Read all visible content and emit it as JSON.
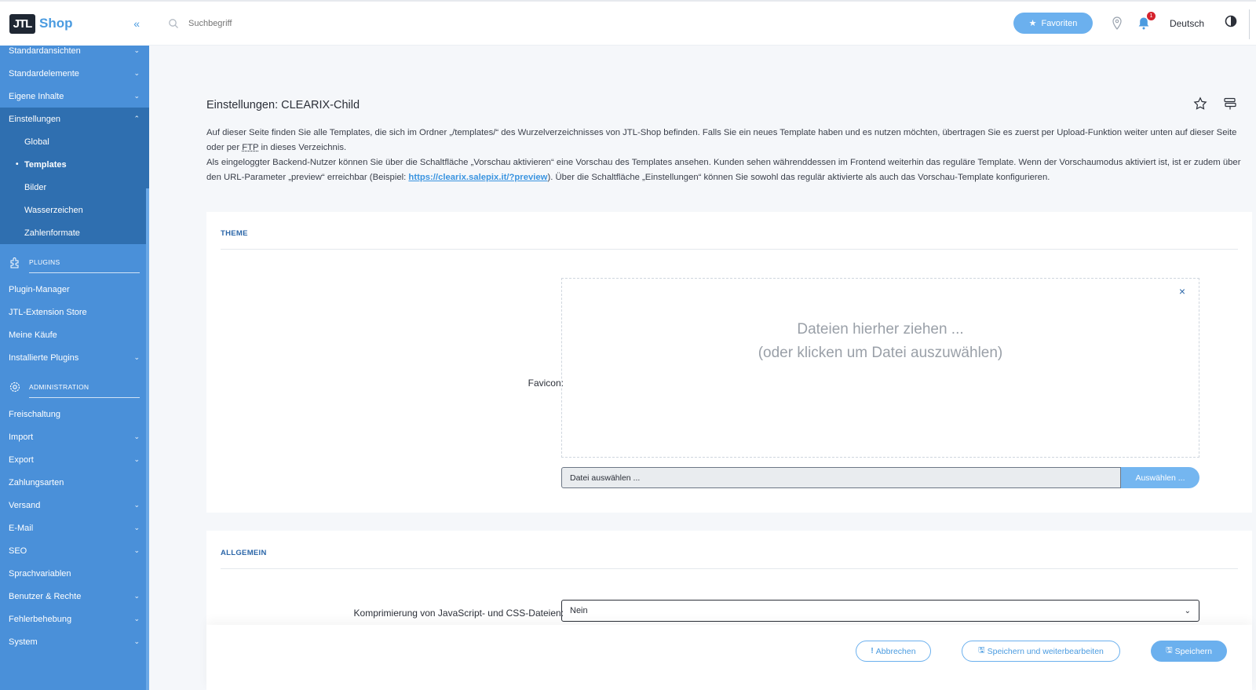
{
  "brand": {
    "logo": "JTL",
    "name": "Shop"
  },
  "sidebar": {
    "items_top": [
      {
        "label": "Standardansichten",
        "chevron": "v"
      },
      {
        "label": "Standardelemente",
        "chevron": "v"
      },
      {
        "label": "Eigene Inhalte",
        "chevron": "v"
      },
      {
        "label": "Einstellungen",
        "chevron": "^"
      }
    ],
    "sub_items": [
      {
        "label": "Global"
      },
      {
        "label": "Templates",
        "bullet": "•"
      },
      {
        "label": "Bilder"
      },
      {
        "label": "Wasserzeichen"
      },
      {
        "label": "Zahlenformate"
      }
    ],
    "plugins_section": "PLUGINS",
    "plugins_items": [
      {
        "label": "Plugin-Manager",
        "chevron": ""
      },
      {
        "label": "JTL-Extension Store",
        "chevron": ""
      },
      {
        "label": "Meine Käufe",
        "chevron": ""
      },
      {
        "label": "Installierte Plugins",
        "chevron": "v"
      }
    ],
    "admin_section": "ADMINISTRATION",
    "admin_items": [
      {
        "label": "Freischaltung",
        "chevron": ""
      },
      {
        "label": "Import",
        "chevron": "v"
      },
      {
        "label": "Export",
        "chevron": "v"
      },
      {
        "label": "Zahlungsarten",
        "chevron": ""
      },
      {
        "label": "Versand",
        "chevron": "v"
      },
      {
        "label": "E-Mail",
        "chevron": "v"
      },
      {
        "label": "SEO",
        "chevron": "v"
      },
      {
        "label": "Sprachvariablen",
        "chevron": ""
      },
      {
        "label": "Benutzer & Rechte",
        "chevron": "v"
      },
      {
        "label": "Fehlerbehebung",
        "chevron": "v"
      },
      {
        "label": "System",
        "chevron": "v"
      }
    ]
  },
  "topbar": {
    "search_placeholder": "Suchbegriff",
    "favorites_label": "Favoriten",
    "notification_count": "1",
    "language": "Deutsch"
  },
  "page": {
    "title": "Einstellungen: CLEARIX-Child",
    "desc_1a": "Auf dieser Seite finden Sie alle Templates, die sich im Ordner „/templates/“ des Wurzelverzeichnisses von JTL-Shop befinden. Falls Sie ein neues Template haben und es nutzen möchten, übertragen Sie es zuerst per Upload-Funktion weiter unten auf dieser Seite oder per ",
    "desc_1_abbr": "FTP",
    "desc_1b": " in dieses Verzeichnis.",
    "desc_2a": "Als eingeloggter Backend-Nutzer können Sie über die Schaltfläche „Vorschau aktivieren“ eine Vorschau des Templates ansehen. Kunden sehen währenddessen im Frontend weiterhin das reguläre Template. Wenn der Vorschaumodus aktiviert ist, ist er zudem über den URL-Parameter „preview“ erreichbar (Beispiel: ",
    "desc_2_link": "https://clearix.salepix.it/?preview",
    "desc_2b": "). Über die Schaltfläche „Einstellungen“ können Sie sowohl das regulär aktivierte als auch das Vorschau-Template konfigurieren."
  },
  "theme_card": {
    "title": "THEME",
    "favicon_label": "Favicon:",
    "dropzone_line1": "Dateien hierher ziehen ...",
    "dropzone_line2": "(oder klicken um Datei auszuwählen)",
    "close_symbol": "×",
    "file_placeholder": "Datei auswählen ...",
    "file_button": "Auswählen ..."
  },
  "general_card": {
    "title": "ALLGEMEIN",
    "compress_label": "Komprimierung von JavaScript- und CSS-Dateien:",
    "compress_value": "Nein"
  },
  "actions": {
    "cancel": "Abbrechen",
    "save_continue": "Speichern und weiterbearbeiten",
    "save": "Speichern"
  }
}
